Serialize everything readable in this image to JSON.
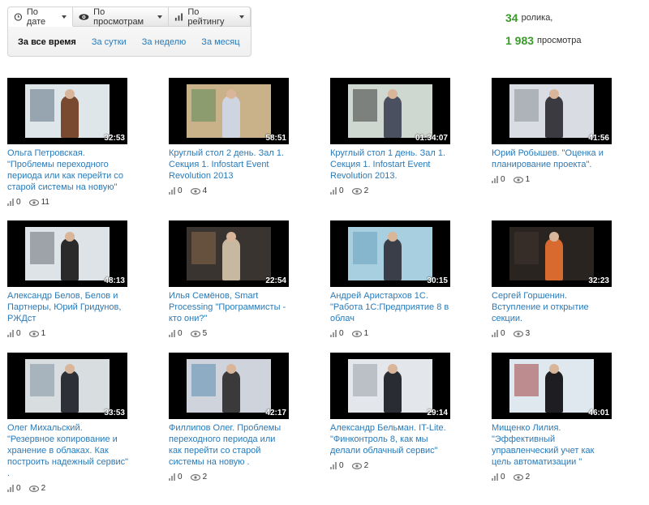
{
  "sort": {
    "by_date": "По дате",
    "by_views": "По просмотрам",
    "by_rating": "По рейтингу"
  },
  "periods": [
    "За все время",
    "За сутки",
    "За неделю",
    "За месяц"
  ],
  "stats": {
    "videos_count": "34",
    "videos_label": "ролика,",
    "views_count": "1 983",
    "views_label": "просмотра"
  },
  "videos": [
    {
      "title": "Ольга Петровская. \"Проблемы переходного периода или как перейти со старой системы на новую\"",
      "duration": "32:53",
      "rating": "0",
      "views": "11",
      "scene": {
        "bg": "#dfe6ea",
        "person": "#7a4a30",
        "accent": "#5b7080"
      }
    },
    {
      "title": "Круглый стол 2 день. Зал 1. Секция 1. Infostart Event Revolution 2013",
      "duration": "58:51",
      "rating": "0",
      "views": "4",
      "scene": {
        "bg": "#c9b28a",
        "person": "#cfd5e0",
        "accent": "#5a8a5a"
      }
    },
    {
      "title": "Круглый стол 1 день. Зал 1. Секция 1. Infostart Event Revolution 2013.",
      "duration": "01:34:07",
      "rating": "0",
      "views": "2",
      "scene": {
        "bg": "#cfd8d0",
        "person": "#4a5060",
        "accent": "#3a3a3a"
      }
    },
    {
      "title": "Юрий Робышев. \"Оценка и планирование проекта\".",
      "duration": "41:56",
      "rating": "0",
      "views": "1",
      "scene": {
        "bg": "#d9dde3",
        "person": "#3a3a40",
        "accent": "#8a8f99"
      }
    },
    {
      "title": "Александр Белов, Белов и Партнеры, Юрий Гридунов, РЖДст",
      "duration": "48:13",
      "rating": "0",
      "views": "1",
      "scene": {
        "bg": "#dde3e6",
        "person": "#2a2a2a",
        "accent": "#6a7076"
      }
    },
    {
      "title": "Илья Семёнов, Smart Processing \"Программисты - кто они?\"",
      "duration": "22:54",
      "rating": "0",
      "views": "5",
      "scene": {
        "bg": "#3a3430",
        "person": "#c8b8a0",
        "accent": "#8a6a4a"
      }
    },
    {
      "title": "Андрей Аристархов 1С. \"Работа 1С:Предприятие 8 в облач",
      "duration": "30:15",
      "rating": "0",
      "views": "1",
      "scene": {
        "bg": "#a8cfe0",
        "person": "#3a3e48",
        "accent": "#6aa0c0"
      }
    },
    {
      "title": "Сергей Горшенин. Вступление и открытие секции.",
      "duration": "32:23",
      "rating": "0",
      "views": "3",
      "scene": {
        "bg": "#2a2420",
        "person": "#d86a30",
        "accent": "#403530"
      }
    },
    {
      "title": "Олег Михальский. \"Резервное копирование и хранение в облаках. Как построить надежный сервис\" .",
      "duration": "33:53",
      "rating": "0",
      "views": "2",
      "scene": {
        "bg": "#d8dde0",
        "person": "#2e3038",
        "accent": "#8090a0"
      }
    },
    {
      "title": "Филлипов Олег. Проблемы переходного периода или как перейти со старой системы на новую .",
      "duration": "42:17",
      "rating": "0",
      "views": "2",
      "scene": {
        "bg": "#cfd4dc",
        "person": "#3a3a3a",
        "accent": "#5a8ab0"
      }
    },
    {
      "title": "Александр Бельман. IT-Lite. \"Финконтроль 8, как мы делали облачный сервис\"",
      "duration": "29:14",
      "rating": "0",
      "views": "2",
      "scene": {
        "bg": "#e3e6ea",
        "person": "#2a2c34",
        "accent": "#9aa0a8"
      }
    },
    {
      "title": "Мищенко Лилия. \"Эффективный управленческий учет как цель автоматизации \"",
      "duration": "46:01",
      "rating": "0",
      "views": "2",
      "scene": {
        "bg": "#dfe8ee",
        "person": "#1e1e22",
        "accent": "#a04040"
      }
    }
  ]
}
